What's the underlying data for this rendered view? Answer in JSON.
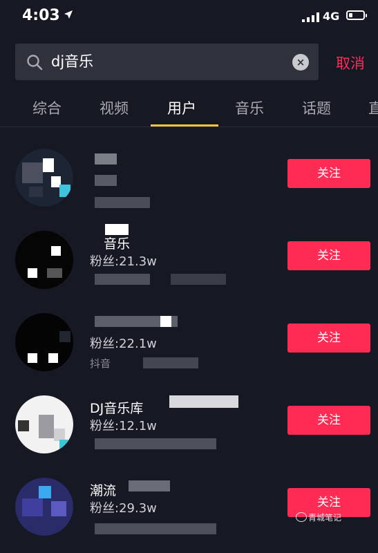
{
  "status_bar": {
    "time": "4:03",
    "network": "4G"
  },
  "search": {
    "query": "dj音乐",
    "cancel_label": "取消"
  },
  "tabs": [
    {
      "label": "综合"
    },
    {
      "label": "视频"
    },
    {
      "label": "用户",
      "active": true
    },
    {
      "label": "音乐"
    },
    {
      "label": "话题"
    },
    {
      "label": "直"
    }
  ],
  "users": [
    {
      "name": "",
      "fans": "",
      "desc": "",
      "follow_label": "关注"
    },
    {
      "name": "音乐",
      "fans": "粉丝:21.3w",
      "desc": "",
      "follow_label": "关注"
    },
    {
      "name": "",
      "fans": "粉丝:22.1w",
      "desc": "抖音",
      "follow_label": "关注"
    },
    {
      "name": "DJ音乐库",
      "fans": "粉丝:12.1w",
      "desc": "",
      "follow_label": "关注"
    },
    {
      "name": "潮流",
      "fans": "粉丝:29.3w",
      "desc": "",
      "follow_label": "关注"
    }
  ],
  "watermark": {
    "text": "青城笔记"
  },
  "colors": {
    "accent": "#fe2c55",
    "tab_indicator": "#f9c63f",
    "background": "#161824"
  }
}
